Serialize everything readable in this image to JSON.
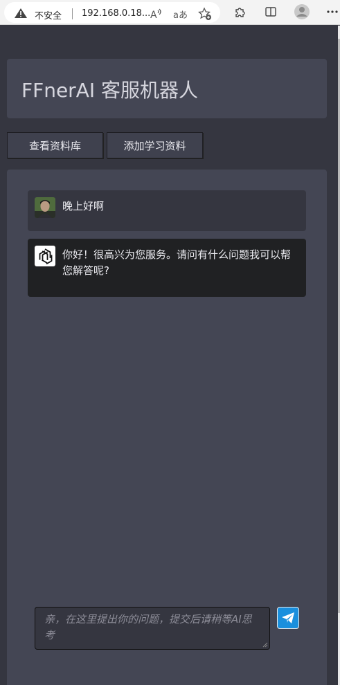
{
  "browser": {
    "security_label": "不安全",
    "url": "192.168.0.18...",
    "read_aloud_label": "Â",
    "translate_label": "aあ"
  },
  "header": {
    "title": "FFnerAI 客服机器人"
  },
  "toolbar": {
    "view_library_label": "查看资料库",
    "add_material_label": "添加学习资料"
  },
  "chat": {
    "messages": [
      {
        "role": "user",
        "text": "晚上好啊"
      },
      {
        "role": "assistant",
        "text": "你好！很高兴为您服务。请问有什么问题我可以帮您解答呢?"
      }
    ]
  },
  "composer": {
    "placeholder": "亲，在这里提出你的问题，提交后请稍等AI思考"
  },
  "colors": {
    "page_bg": "#353640",
    "card_bg": "#444654",
    "assistant_bubble": "#202123",
    "send_button": "#1a8fdd"
  }
}
